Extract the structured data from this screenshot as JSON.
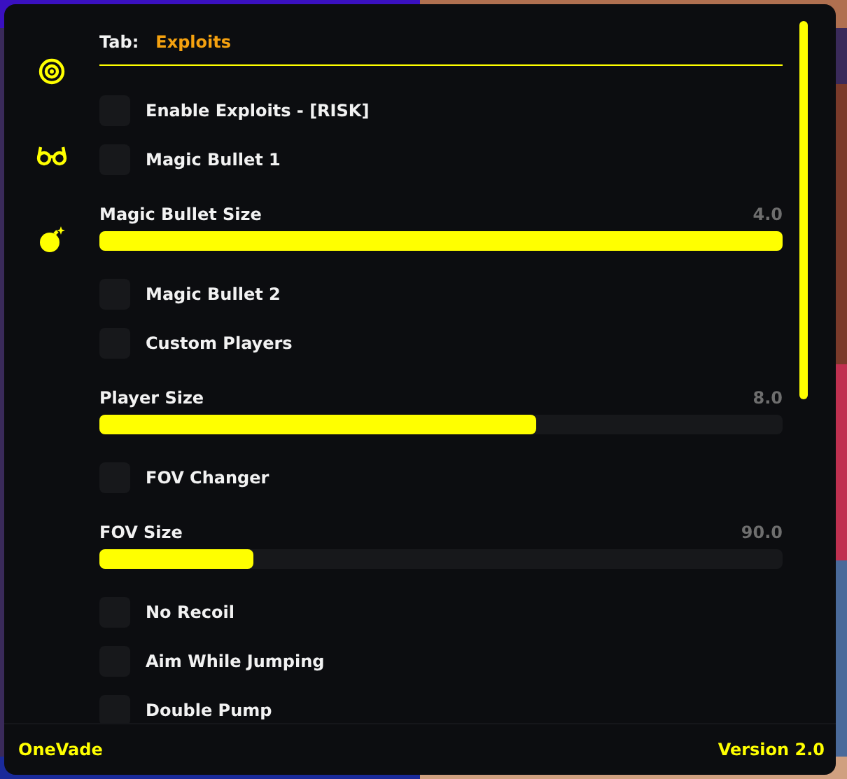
{
  "sidebar": {
    "items": [
      {
        "kind": "target",
        "selected": false
      },
      {
        "kind": "glasses",
        "selected": false
      },
      {
        "kind": "bomb",
        "selected": false
      }
    ]
  },
  "tab": {
    "label": "Tab:",
    "value": "Exploits"
  },
  "items": [
    {
      "kind": "toggle",
      "label": "Enable Exploits - [RISK]",
      "checked": false
    },
    {
      "kind": "toggle",
      "label": "Magic Bullet 1",
      "checked": false
    },
    {
      "kind": "slider",
      "label": "Magic Bullet Size",
      "reading": "4.0",
      "level": 1.0
    },
    {
      "kind": "toggle",
      "label": "Magic Bullet 2",
      "checked": false
    },
    {
      "kind": "toggle",
      "label": "Custom Players",
      "checked": false
    },
    {
      "kind": "slider",
      "label": "Player Size",
      "reading": "8.0",
      "level": 0.64
    },
    {
      "kind": "toggle",
      "label": "FOV Changer",
      "checked": false
    },
    {
      "kind": "slider",
      "label": "FOV Size",
      "reading": "90.0",
      "level": 0.225
    },
    {
      "kind": "toggle",
      "label": "No Recoil",
      "checked": false
    },
    {
      "kind": "toggle",
      "label": "Aim While Jumping",
      "checked": false
    },
    {
      "kind": "toggle",
      "label": "Double Pump",
      "checked": false
    }
  ],
  "footer": {
    "title": "OneVade",
    "version": "Version 2.0"
  }
}
